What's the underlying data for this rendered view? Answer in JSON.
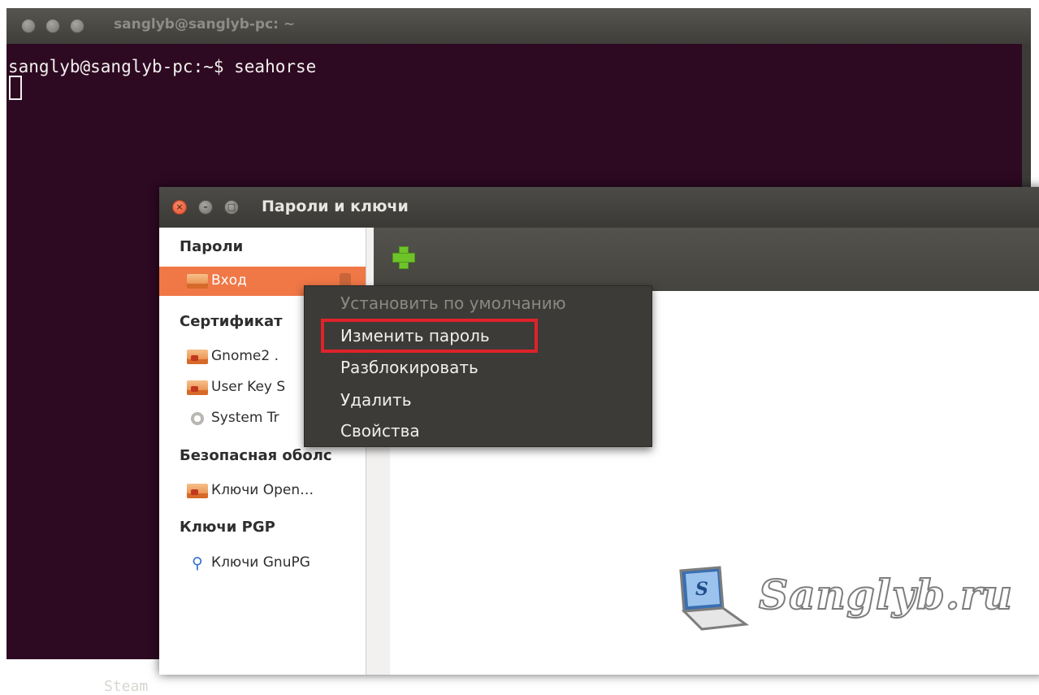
{
  "terminal": {
    "title": "sanglyb@sanglyb-pc: ~",
    "prompt_line": "sanglyb@sanglyb-pc:~$ seahorse",
    "bottom_text": "Steam"
  },
  "seahorse": {
    "title": "Пароли и ключи",
    "sections": {
      "passwords": "Пароли",
      "certificates": "Сертификат",
      "ssh": "Безопасная оболс",
      "pgp": "Ключи PGP"
    },
    "items": {
      "login": "Вход",
      "gnome2": "Gnome2 .",
      "user_key": "User Key S",
      "system_trust": "System Tr",
      "openssh": "Ключи Open…",
      "gnupg": "Ключи GnuPG"
    },
    "selected_color": "#f07746"
  },
  "context_menu": {
    "items": [
      {
        "label": "Установить по умолчанию",
        "enabled": false
      },
      {
        "label": "Изменить пароль",
        "enabled": true,
        "highlighted": true
      },
      {
        "label": "Разблокировать",
        "enabled": true
      },
      {
        "label": "Удалить",
        "enabled": true
      },
      {
        "label": "Свойства",
        "enabled": true
      }
    ],
    "highlight_color": "#e0222a"
  },
  "watermark": {
    "text": "Sanglyb.ru",
    "icon": "laptop-icon"
  }
}
